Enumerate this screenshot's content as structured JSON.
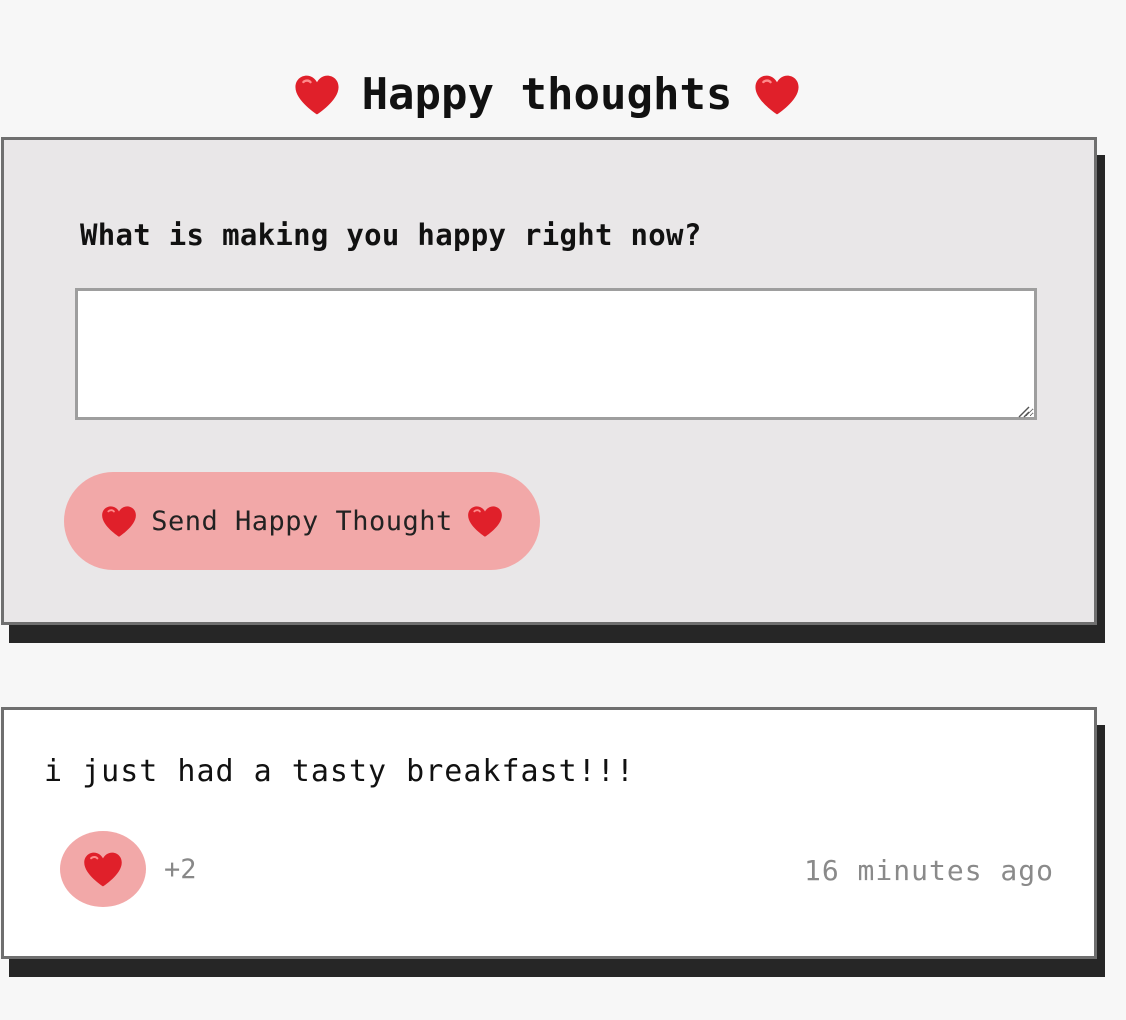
{
  "header": {
    "title": "Happy thoughts",
    "icon": "heart-icon"
  },
  "form": {
    "label": "What is making you happy right now?",
    "input_value": "",
    "input_placeholder": "",
    "send_label": "Send Happy Thought",
    "button_color": "#f2a8a8"
  },
  "thoughts": [
    {
      "message": "i just had a tasty breakfast!!!",
      "likes": "+2",
      "time": "16 minutes ago"
    }
  ],
  "colors": {
    "background": "#f7f7f7",
    "form_background": "#e9e7e8",
    "accent_pink": "#f2a8a8",
    "heart_red": "#e0202a",
    "shadow": "#262626"
  }
}
